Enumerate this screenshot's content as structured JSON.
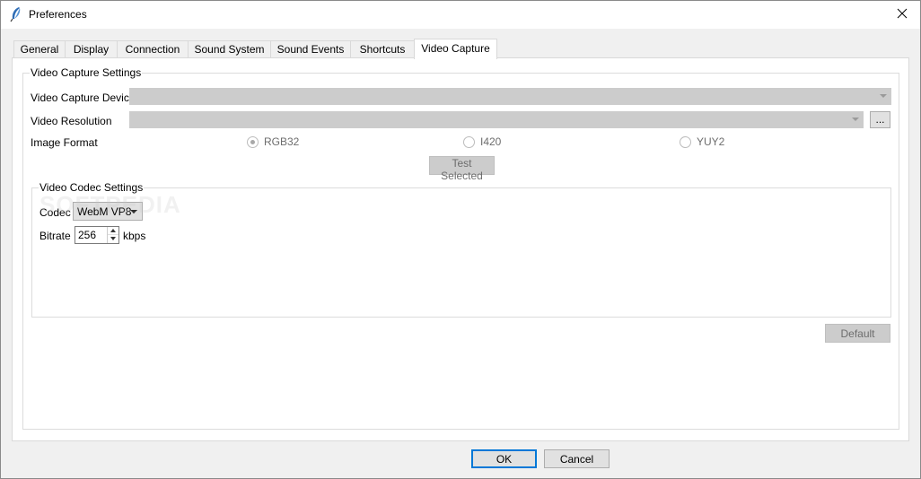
{
  "window": {
    "title": "Preferences"
  },
  "tabs": [
    {
      "label": "General"
    },
    {
      "label": "Display"
    },
    {
      "label": "Connection"
    },
    {
      "label": "Sound System"
    },
    {
      "label": "Sound Events"
    },
    {
      "label": "Shortcuts"
    },
    {
      "label": "Video Capture",
      "active": true
    }
  ],
  "capture": {
    "group_title": "Video Capture Settings",
    "device_label": "Video Capture Device",
    "device_value": "",
    "resolution_label": "Video Resolution",
    "resolution_value": "",
    "browse_label": "...",
    "format_label": "Image Format",
    "formats": [
      {
        "label": "RGB32",
        "checked": true
      },
      {
        "label": "I420",
        "checked": false
      },
      {
        "label": "YUY2",
        "checked": false
      }
    ],
    "test_label": "Test Selected"
  },
  "codec": {
    "group_title": "Video Codec Settings",
    "codec_label": "Codec",
    "codec_value": "WebM VP8",
    "bitrate_label": "Bitrate",
    "bitrate_value": "256",
    "bitrate_unit": "kbps"
  },
  "buttons": {
    "default_label": "Default",
    "ok_label": "OK",
    "cancel_label": "Cancel"
  },
  "watermark": "SOFTPEDIA",
  "icons": {
    "app": "app-feather-icon",
    "close": "close-icon"
  },
  "colors": {
    "accent": "#0078d7",
    "disabled_fill": "#cccccc",
    "panel": "#ffffff",
    "chrome": "#f0f0f0"
  }
}
